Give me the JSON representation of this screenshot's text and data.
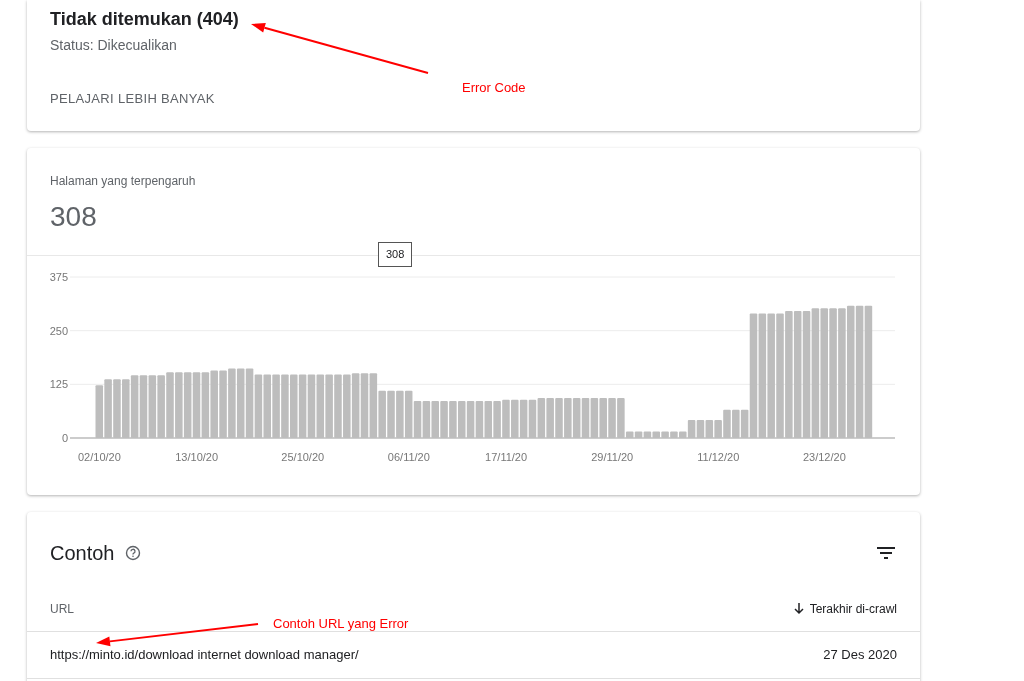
{
  "summary": {
    "title": "Tidak ditemukan (404)",
    "status": "Status: Dikecualikan",
    "learn_more": "PELAJARI LEBIH BANYAK"
  },
  "affected": {
    "label": "Halaman yang terpengaruh",
    "count": "308",
    "tooltip": "308",
    "chart_data": {
      "type": "bar",
      "ylim": [
        0,
        375
      ],
      "categories": [
        "02/10/20",
        null,
        null,
        null,
        null,
        null,
        null,
        null,
        null,
        null,
        null,
        "13/10/20",
        null,
        null,
        null,
        null,
        null,
        null,
        null,
        null,
        null,
        null,
        null,
        "25/10/20",
        null,
        null,
        null,
        null,
        null,
        null,
        null,
        null,
        null,
        null,
        null,
        "06/11/20",
        null,
        null,
        null,
        null,
        null,
        null,
        null,
        null,
        null,
        null,
        "17/11/20",
        null,
        null,
        null,
        null,
        null,
        null,
        null,
        null,
        null,
        null,
        null,
        "29/11/20",
        null,
        null,
        null,
        null,
        null,
        null,
        null,
        null,
        null,
        null,
        null,
        "11/12/20",
        null,
        null,
        null,
        null,
        null,
        null,
        null,
        null,
        null,
        null,
        null,
        "23/12/20",
        null,
        null,
        null,
        null,
        null
      ],
      "yticks": [
        0,
        125,
        250,
        375
      ],
      "values": [
        123,
        137,
        137,
        137,
        146,
        146,
        146,
        146,
        153,
        153,
        153,
        153,
        153,
        157,
        157,
        162,
        162,
        162,
        148,
        148,
        148,
        148,
        148,
        148,
        148,
        148,
        148,
        148,
        148,
        151,
        151,
        151,
        110,
        110,
        110,
        110,
        86,
        86,
        86,
        86,
        86,
        86,
        86,
        86,
        86,
        86,
        89,
        89,
        89,
        89,
        93,
        93,
        93,
        93,
        93,
        93,
        93,
        93,
        93,
        93,
        15,
        15,
        15,
        15,
        15,
        15,
        15,
        42,
        42,
        42,
        42,
        66,
        66,
        66,
        290,
        290,
        290,
        290,
        296,
        296,
        296,
        302,
        302,
        302,
        302,
        308,
        308,
        308
      ]
    }
  },
  "examples": {
    "title": "Contoh",
    "columns": [
      {
        "label": "URL",
        "sorted": false
      },
      {
        "label": "Terakhir di-crawl",
        "sorted": true
      }
    ],
    "rows": [
      {
        "url": "https://minto.id/download internet download manager/",
        "date": "27 Des 2020"
      }
    ]
  },
  "annotations": [
    {
      "text": "Error Code"
    },
    {
      "text": "Contoh URL yang Error"
    }
  ]
}
